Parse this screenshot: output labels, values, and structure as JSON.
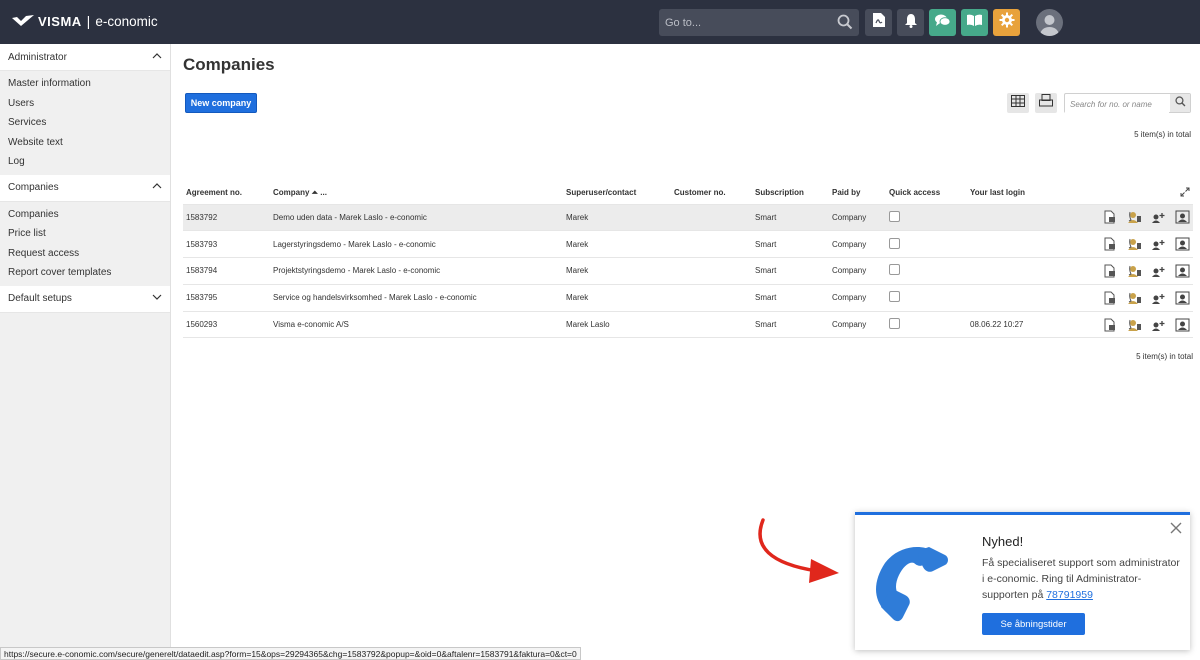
{
  "app": {
    "brand": "VISMA",
    "product": "e-conomic",
    "separator": "|",
    "goto_placeholder": "Go to..."
  },
  "icons": {
    "search": "search-icon",
    "pdf": "pdf-document-icon",
    "bell": "bell-icon",
    "chat": "chat-icon",
    "book": "book-icon",
    "gear": "gear-icon",
    "avatar": "user-avatar-icon"
  },
  "sidebar": {
    "sections": [
      {
        "label": "Administrator",
        "expanded": true,
        "items": [
          "Master information",
          "Users",
          "Services",
          "Website text",
          "Log"
        ]
      },
      {
        "label": "Companies",
        "expanded": true,
        "items": [
          "Companies",
          "Price list",
          "Request access",
          "Report cover templates"
        ]
      },
      {
        "label": "Default setups",
        "expanded": false,
        "items": []
      }
    ]
  },
  "main": {
    "title": "Companies",
    "new_button": "New company",
    "search_placeholder": "Search for no. or name",
    "count_top": "5 item(s) in total",
    "count_bottom": "5 item(s) in total",
    "columns": [
      "Agreement no.",
      "Company ⏶ ...",
      "Superuser/contact",
      "Customer no.",
      "Subscription",
      "Paid by",
      "Quick access",
      "Your last login"
    ],
    "rows": [
      {
        "agreement": "1583792",
        "company": "Demo uden data - Marek Laslo - e-conomic",
        "contact": "Marek",
        "customer": "",
        "subscription": "Smart",
        "paid_by": "Company",
        "quick_access": false,
        "last_login": ""
      },
      {
        "agreement": "1583793",
        "company": "Lagerstyringsdemo - Marek Laslo - e-conomic",
        "contact": "Marek",
        "customer": "",
        "subscription": "Smart",
        "paid_by": "Company",
        "quick_access": false,
        "last_login": ""
      },
      {
        "agreement": "1583794",
        "company": "Projektstyringsdemo - Marek Laslo - e-conomic",
        "contact": "Marek",
        "customer": "",
        "subscription": "Smart",
        "paid_by": "Company",
        "quick_access": false,
        "last_login": ""
      },
      {
        "agreement": "1583795",
        "company": "Service og handelsvirksomhed - Marek Laslo - e-conomic",
        "contact": "Marek",
        "customer": "",
        "subscription": "Smart",
        "paid_by": "Company",
        "quick_access": false,
        "last_login": ""
      },
      {
        "agreement": "1560293",
        "company": "Visma e-conomic A/S",
        "contact": "Marek Laslo",
        "customer": "",
        "subscription": "Smart",
        "paid_by": "Company",
        "quick_access": false,
        "last_login": "08.06.22 10:27"
      }
    ]
  },
  "status_url": "https://secure.e-conomic.com/secure/generelt/dataedit.asp?form=15&ops=29294365&chg=1583792&popup=&oid=0&aftalenr=1583791&faktura=0&ct=0",
  "notification": {
    "title": "Nyhed!",
    "body": "Få specialiseret support som administrator i e-conomic. Ring til Administrator-supporten på ",
    "phone": "78791959",
    "button": "Se åbningstider"
  },
  "colors": {
    "topbar": "#2c3140",
    "primary": "#1f6fde",
    "teal": "#46a98a",
    "orange": "#e8a23c",
    "arrow": "#e0271c"
  }
}
